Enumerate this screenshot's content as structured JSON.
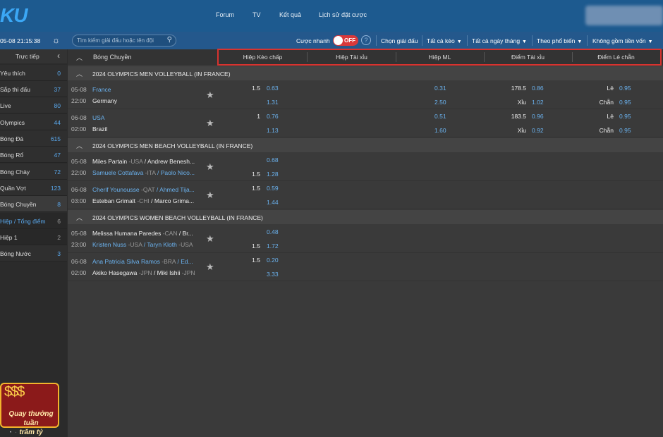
{
  "brand": {
    "logo": "KU"
  },
  "nav": [
    {
      "label": "Forum"
    },
    {
      "label": "TV"
    },
    {
      "label": "Kết quả"
    },
    {
      "label": "Lịch sử đặt cược"
    }
  ],
  "toolbar": {
    "clock": "05-08  21:15:38",
    "search_placeholder": "Tìm kiếm giải đấu hoặc tên đội",
    "quick_bet_label": "Cược nhanh",
    "quick_bet_state": "OFF",
    "filters": [
      {
        "label": "Chọn giải đấu"
      },
      {
        "label": "Tất cả kèo"
      },
      {
        "label": "Tất cả ngày tháng"
      },
      {
        "label": "Theo phổ biến"
      },
      {
        "label": "Không gồm tiền vốn"
      }
    ]
  },
  "sidebar": {
    "header": "Trực tiếp",
    "items": [
      {
        "label": "Yêu thích",
        "count": "0"
      },
      {
        "label": "Sắp thi đấu",
        "count": "37"
      },
      {
        "label": "Live",
        "count": "80"
      },
      {
        "label": "Olympics",
        "count": "44"
      },
      {
        "label": "Bóng Đá",
        "count": "615"
      },
      {
        "label": "Bóng Rổ",
        "count": "47"
      },
      {
        "label": "Bóng Chày",
        "count": "72"
      },
      {
        "label": "Quần Vợt",
        "count": "123"
      },
      {
        "label": "Bóng Chuyền",
        "count": "8"
      },
      {
        "label": "Hiệp / Tổng điểm",
        "count": "6"
      },
      {
        "label": "Hiệp 1",
        "count": "2"
      },
      {
        "label": "Bóng Nước",
        "count": "3"
      }
    ]
  },
  "promo": {
    "line1": "Quay thưởng tuần",
    "line2": "trăm tỷ"
  },
  "table": {
    "sport": "Bóng Chuyền",
    "columns": [
      "Hiệp Kèo chấp",
      "Hiệp Tài xỉu",
      "Hiệp ML",
      "Điểm Tài xỉu",
      "Điểm Lẻ chẵn"
    ],
    "leagues": [
      {
        "name": "2024 OLYMPICS MEN VOLLEYBALL (IN FRANCE)",
        "matches": [
          {
            "date": "05-08",
            "time": "22:00",
            "home": "France",
            "away": "Germany",
            "hdp": "1.5",
            "hdp_home": "0.63",
            "hdp_away": "1.31",
            "ml_home": "0.31",
            "ml_away": "2.50",
            "ou_line": "178.5",
            "ou_over": "0.86",
            "ou_under_label": "Xỉu",
            "ou_under": "1.02",
            "oe_odd_label": "Lẻ",
            "oe_odd": "0.95",
            "oe_even_label": "Chẵn",
            "oe_even": "0.95"
          },
          {
            "date": "06-08",
            "time": "02:00",
            "home": "USA",
            "away": "Brazil",
            "hdp": "1",
            "hdp_home": "0.76",
            "hdp_away": "1.13",
            "ml_home": "0.51",
            "ml_away": "1.60",
            "ou_line": "183.5",
            "ou_over": "0.96",
            "ou_under_label": "Xỉu",
            "ou_under": "0.92",
            "oe_odd_label": "Lẻ",
            "oe_odd": "0.95",
            "oe_even_label": "Chẵn",
            "oe_even": "0.95"
          }
        ]
      },
      {
        "name": "2024 OLYMPICS MEN BEACH VOLLEYBALL (IN FRANCE)",
        "matches": [
          {
            "date": "05-08",
            "time": "22:00",
            "home_a": "Miles Partain",
            "home_a_c": "-USA",
            "home_b": "Andrew Benesh...",
            "away_a": "Samuele Cottafava",
            "away_a_c": "-ITA",
            "away_b": "Paolo Nico...",
            "hdp_home": "0.68",
            "hdp_away_line": "1.5",
            "hdp_away": "1.28"
          },
          {
            "date": "06-08",
            "time": "03:00",
            "home_a": "Cherif Younousse",
            "home_a_c": "-QAT",
            "home_b": "Ahmed Tija...",
            "away_a": "Esteban Grimalt",
            "away_a_c": "-CHI",
            "away_b": "Marco Grima...",
            "hdp_home_line": "1.5",
            "hdp_home": "0.59",
            "hdp_away": "1.44"
          }
        ]
      },
      {
        "name": "2024 OLYMPICS WOMEN BEACH VOLLEYBALL (IN FRANCE)",
        "matches": [
          {
            "date": "05-08",
            "time": "23:00",
            "home_a": "Melissa Humana Paredes",
            "home_a_c": "-CAN",
            "home_b": "Br...",
            "away_a": "Kristen Nuss",
            "away_a_c": "-USA",
            "away_b": "Taryn Kloth",
            "away_b_c": "-USA",
            "hdp_home": "0.48",
            "hdp_away_line": "1.5",
            "hdp_away": "1.72"
          },
          {
            "date": "06-08",
            "time": "02:00",
            "home_a": "Ana Patricia Silva Ramos",
            "home_a_c": "-BRA",
            "home_b": "Ed...",
            "away_a": "Akiko Hasegawa",
            "away_a_c": "-JPN",
            "away_b": "Miki Ishii",
            "away_b_c": "-JPN",
            "hdp_home_line": "1.5",
            "hdp_home": "0.20",
            "hdp_away": "3.33"
          }
        ]
      }
    ]
  }
}
